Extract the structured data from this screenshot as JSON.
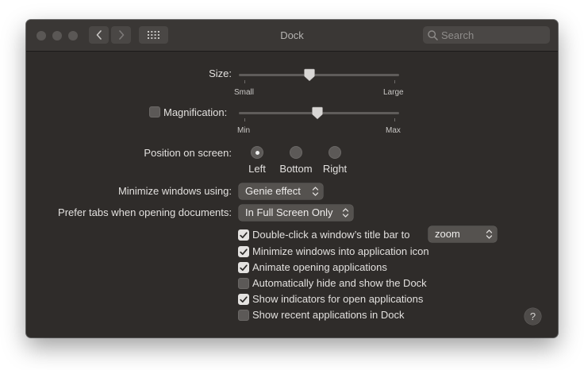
{
  "window": {
    "title": "Dock"
  },
  "search": {
    "placeholder": "Search",
    "value": ""
  },
  "size": {
    "label": "Size:",
    "min_label": "Small",
    "max_label": "Large",
    "value": 0.44
  },
  "magnification": {
    "label": "Magnification:",
    "checked": false,
    "min_label": "Min",
    "max_label": "Max",
    "value": 0.49
  },
  "position": {
    "label": "Position on screen:",
    "options": [
      "Left",
      "Bottom",
      "Right"
    ],
    "selected": "Left"
  },
  "minimize": {
    "label": "Minimize windows using:",
    "value": "Genie effect"
  },
  "prefer_tabs": {
    "label": "Prefer tabs when opening documents:",
    "value": "In Full Screen Only"
  },
  "options": [
    {
      "label": "Double-click a window’s title bar to",
      "checked": true
    },
    {
      "label": "Minimize windows into application icon",
      "checked": true
    },
    {
      "label": "Animate opening applications",
      "checked": true
    },
    {
      "label": "Automatically hide and show the Dock",
      "checked": false
    },
    {
      "label": "Show indicators for open applications",
      "checked": true
    },
    {
      "label": "Show recent applications in Dock",
      "checked": false
    }
  ],
  "double_click_action": {
    "value": "zoom"
  },
  "help": {
    "label": "?"
  },
  "icons": {
    "back": "chevron-left-icon",
    "forward": "chevron-right-icon",
    "grid": "grid-icon",
    "search": "search-icon",
    "popup_arrows": "up-down-arrows-icon",
    "checkmark": "checkmark-icon"
  },
  "colors": {
    "window_bg": "#2f2c2a",
    "titlebar_bg": "#3a3735",
    "text": "#e2e0de",
    "checkbox_on": "#e4e2e0"
  }
}
